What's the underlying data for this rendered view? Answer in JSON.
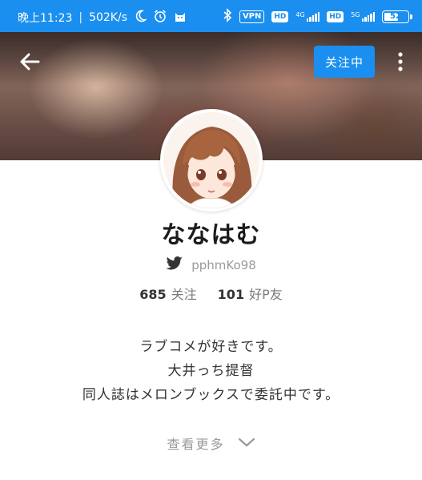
{
  "status_bar": {
    "time": "晚上11:23",
    "network_speed": "502K/s",
    "vpn_label": "VPN",
    "hd1_label": "HD",
    "hd2_label": "HD",
    "net1_label": "4G",
    "net2_label": "5G",
    "battery_level": "52",
    "icons": [
      "moon-icon",
      "alarm-icon",
      "cat-icon",
      "bluetooth-icon",
      "signal-icon",
      "battery-icon"
    ]
  },
  "header": {
    "follow_label": "关注中",
    "icons": [
      "back-arrow-icon",
      "more-vert-icon"
    ]
  },
  "profile": {
    "name": "ななはむ",
    "twitter_handle": "pphmKo98",
    "following_count": "685",
    "following_label": "关注",
    "friends_count": "101",
    "friends_label": "好P友"
  },
  "bio": {
    "line1": "ラブコメが好きです。",
    "line2": "大井っち提督",
    "line3": "同人誌はメロンブックスで委託中です。"
  },
  "see_more": {
    "label": "查看更多"
  },
  "colors": {
    "accent": "#1a8ff0",
    "text_primary": "#1c1c1c",
    "text_secondary": "#9a9a9a",
    "twitter": "#333333"
  }
}
